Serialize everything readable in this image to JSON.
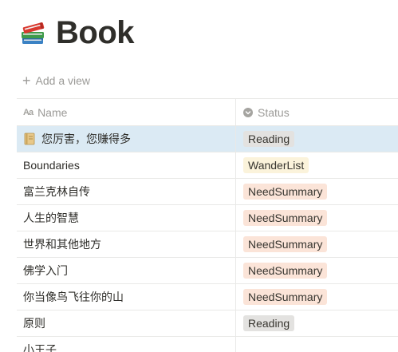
{
  "page": {
    "title": "Book",
    "title_icon": "books-emoji-icon",
    "add_view_label": "Add a view"
  },
  "table": {
    "columns": [
      {
        "label": "Name",
        "icon": "text-aa-icon"
      },
      {
        "label": "Status",
        "icon": "select-chevron-icon"
      }
    ],
    "rows": [
      {
        "name": "您厉害，您赚得多",
        "status": "Reading",
        "status_color": "gray",
        "has_page_icon": true,
        "selected": true
      },
      {
        "name": "Boundaries",
        "status": "WanderList",
        "status_color": "yellow"
      },
      {
        "name": "富兰克林自传",
        "status": "NeedSummary",
        "status_color": "orange"
      },
      {
        "name": "人生的智慧",
        "status": "NeedSummary",
        "status_color": "orange"
      },
      {
        "name": "世界和其他地方",
        "status": "NeedSummary",
        "status_color": "orange"
      },
      {
        "name": "佛学入门",
        "status": "NeedSummary",
        "status_color": "orange"
      },
      {
        "name": "你当像鸟飞往你的山",
        "status": "NeedSummary",
        "status_color": "orange"
      },
      {
        "name": "原则",
        "status": "Reading",
        "status_color": "gray"
      },
      {
        "name": "小王子",
        "status": "",
        "status_color": ""
      }
    ]
  },
  "colors": {
    "selected_row_bg": "#dbeaf4",
    "tag_gray": "#e3e2e0",
    "tag_yellow": "#fbf3db",
    "tag_orange": "#fbe4d8"
  }
}
